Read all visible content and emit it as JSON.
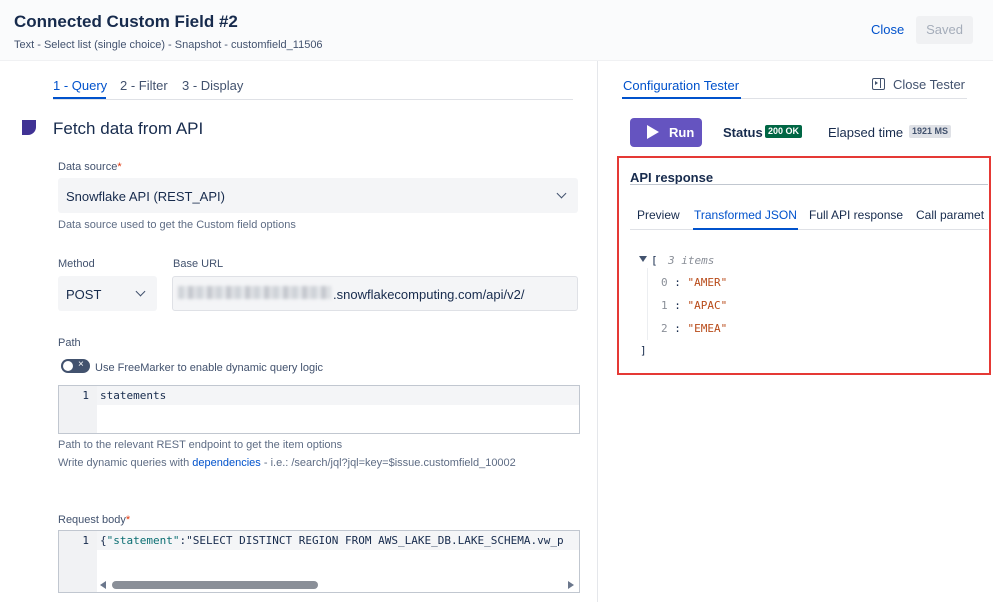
{
  "header": {
    "title": "Connected Custom Field #2",
    "subtitle": "Text - Select list (single choice) - Snapshot - customfield_11506",
    "close_label": "Close",
    "saved_label": "Saved"
  },
  "steps": {
    "tabs": [
      {
        "label": "1 - Query",
        "active": true
      },
      {
        "label": "2 - Filter",
        "active": false
      },
      {
        "label": "3 - Display",
        "active": false
      }
    ]
  },
  "section": {
    "title": "Fetch data from API"
  },
  "data_source": {
    "label": "Data source",
    "required_mark": "*",
    "value": "Snowflake API (REST_API)",
    "helper": "Data source used to get the Custom field options"
  },
  "method": {
    "label": "Method",
    "value": "POST"
  },
  "base_url": {
    "label": "Base URL",
    "value_visible": ".snowflakecomputing.com/api/v2/"
  },
  "path": {
    "label": "Path",
    "toggle_label": "Use FreeMarker to enable dynamic query logic",
    "toggle_x": "×",
    "line_number": "1",
    "code": "statements",
    "helper1": "Path to the relevant REST endpoint to get the item options",
    "helper2_prefix": "Write dynamic queries with ",
    "helper2_link": "dependencies",
    "helper2_suffix": " - i.e.: /search/jql?jql=key=$issue.customfield_10002"
  },
  "request_body": {
    "label": "Request body",
    "required_mark": "*",
    "line_number": "1",
    "code_brace": "{",
    "code_key": "\"statement\"",
    "code_colon": ":",
    "code_value": "\"SELECT DISTINCT REGION FROM AWS_LAKE_DB.LAKE_SCHEMA.vw_p"
  },
  "tester": {
    "tab_label": "Configuration Tester",
    "close_label": "Close Tester",
    "run_label": "Run",
    "status_label": "Status",
    "status_value": "200 OK",
    "elapsed_label": "Elapsed time",
    "elapsed_value": "1921 MS",
    "api_title": "API response",
    "response_tabs": [
      {
        "label": "Preview",
        "active": false
      },
      {
        "label": "Transformed JSON",
        "active": true
      },
      {
        "label": "Full API response",
        "active": false
      },
      {
        "label": "Call paramet",
        "active": false
      }
    ],
    "json": {
      "open": "[",
      "count": "3 items",
      "items": [
        {
          "index": "0",
          "value": "\"AMER\""
        },
        {
          "index": "1",
          "value": "\"APAC\""
        },
        {
          "index": "2",
          "value": "\"EMEA\""
        }
      ],
      "close": "]"
    }
  },
  "colors": {
    "accent": "#0052cc",
    "run_button": "#6554c0",
    "status_ok": "#006644",
    "highlight": "#e53935"
  }
}
